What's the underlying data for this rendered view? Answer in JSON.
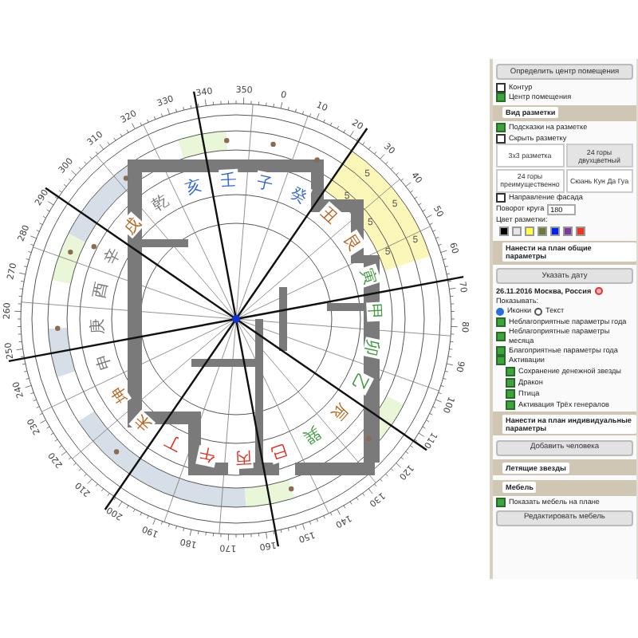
{
  "compass": {
    "degree_labels": [
      "0",
      "10",
      "20",
      "30",
      "40",
      "50",
      "60",
      "70",
      "80",
      "90",
      "100",
      "110",
      "120",
      "130",
      "140",
      "150",
      "160",
      "170",
      "180",
      "190",
      "200",
      "210",
      "220",
      "230",
      "240",
      "250",
      "260",
      "270",
      "280",
      "290",
      "300",
      "310",
      "320",
      "330",
      "340",
      "350"
    ],
    "mountains": [
      {
        "char": "子",
        "color": "#3366cc"
      },
      {
        "char": "癸",
        "color": "#3366cc"
      },
      {
        "char": "丑",
        "color": "#b8651f"
      },
      {
        "char": "艮",
        "color": "#b8651f"
      },
      {
        "char": "寅",
        "color": "#3a9a3a"
      },
      {
        "char": "甲",
        "color": "#3a9a3a"
      },
      {
        "char": "卯",
        "color": "#3a9a3a"
      },
      {
        "char": "乙",
        "color": "#3a9a3a"
      },
      {
        "char": "辰",
        "color": "#b8651f"
      },
      {
        "char": "巽",
        "color": "#3a9a3a"
      },
      {
        "char": "巳",
        "color": "#e03020"
      },
      {
        "char": "丙",
        "color": "#e03020"
      },
      {
        "char": "午",
        "color": "#e03020"
      },
      {
        "char": "丁",
        "color": "#e03020"
      },
      {
        "char": "未",
        "color": "#b8651f"
      },
      {
        "char": "坤",
        "color": "#b8651f"
      },
      {
        "char": "申",
        "color": "#777777"
      },
      {
        "char": "庚",
        "color": "#777777"
      },
      {
        "char": "酉",
        "color": "#777777"
      },
      {
        "char": "辛",
        "color": "#777777"
      },
      {
        "char": "戌",
        "color": "#b8651f"
      },
      {
        "char": "乾",
        "color": "#777777"
      },
      {
        "char": "亥",
        "color": "#3366cc"
      },
      {
        "char": "壬",
        "color": "#3366cc"
      }
    ],
    "highlight_numbers": [
      "5",
      "5",
      "5",
      "5",
      "5",
      "5"
    ]
  },
  "sidebar": {
    "items": [
      {
        "kind": "button",
        "label": "Определить центр помещения"
      },
      {
        "kind": "checkbox",
        "label": "Контур",
        "checked": false
      },
      {
        "kind": "checkbox",
        "label": "Центр помещения",
        "checked": true
      },
      {
        "kind": "header",
        "label": "Вид разметки"
      },
      {
        "kind": "checkbox",
        "label": "Подсказки на разметке",
        "checked": true
      },
      {
        "kind": "checkbox",
        "label": "Скрыть разметку",
        "checked": false
      },
      {
        "kind": "button_row",
        "buttons": [
          {
            "label": "3х3 разметка",
            "selected": false
          },
          {
            "label": "24 горы двухцветный",
            "selected": true
          }
        ]
      },
      {
        "kind": "button_row",
        "buttons": [
          {
            "label": "24 горы преимущественно",
            "selected": false
          },
          {
            "label": "Сюань Кун Да Гуа",
            "selected": false
          }
        ]
      },
      {
        "kind": "checkbox",
        "label": "Направление фасада",
        "checked": false
      },
      {
        "kind": "spinner",
        "label": "Поворот круга",
        "value": "180"
      },
      {
        "kind": "swatches",
        "label": "Цвет разметки:",
        "colors": [
          {
            "color": "#000000"
          },
          {
            "color": "#e6e6e6"
          },
          {
            "color": "#ffff44"
          },
          {
            "color": "#6b7a3a"
          },
          {
            "color": "#0022ee"
          },
          {
            "color": "#7a3aa0"
          },
          {
            "color": "#ee3322"
          }
        ]
      },
      {
        "kind": "header",
        "label": "Нанести на план общие параметры"
      },
      {
        "kind": "button",
        "label": "Указать дату"
      },
      {
        "kind": "date",
        "label": "26.11.2016 Москва, Россия"
      },
      {
        "kind": "text",
        "label": "Показывать:"
      },
      {
        "kind": "radios",
        "options": [
          {
            "label": "Иконки",
            "selected": true
          },
          {
            "label": "Текст",
            "selected": false
          }
        ]
      },
      {
        "kind": "checkbox",
        "label": "Неблагоприятные параметры года",
        "checked": true
      },
      {
        "kind": "checkbox",
        "label": "Неблагоприятные параметры месяца",
        "checked": true
      },
      {
        "kind": "checkbox",
        "label": "Благоприятные параметры года",
        "checked": true
      },
      {
        "kind": "checkbox",
        "label": "Активации",
        "checked": true,
        "children": [
          {
            "label": "Сохранение денежной звезды",
            "checked": true
          },
          {
            "label": "Дракон",
            "checked": true
          },
          {
            "label": "Птица",
            "checked": true
          },
          {
            "label": "Активация Трёх генералов",
            "checked": true
          }
        ]
      },
      {
        "kind": "header",
        "label": "Нанести на план индивидуальные параметры"
      },
      {
        "kind": "button",
        "label": "Добавить человека"
      },
      {
        "kind": "header",
        "label": "Летящие звезды"
      },
      {
        "kind": "header",
        "label": "Мебель"
      },
      {
        "kind": "checkbox",
        "label": "Показать мебель на плане",
        "checked": true
      },
      {
        "kind": "button",
        "label": "Редактировать мебель"
      }
    ]
  }
}
